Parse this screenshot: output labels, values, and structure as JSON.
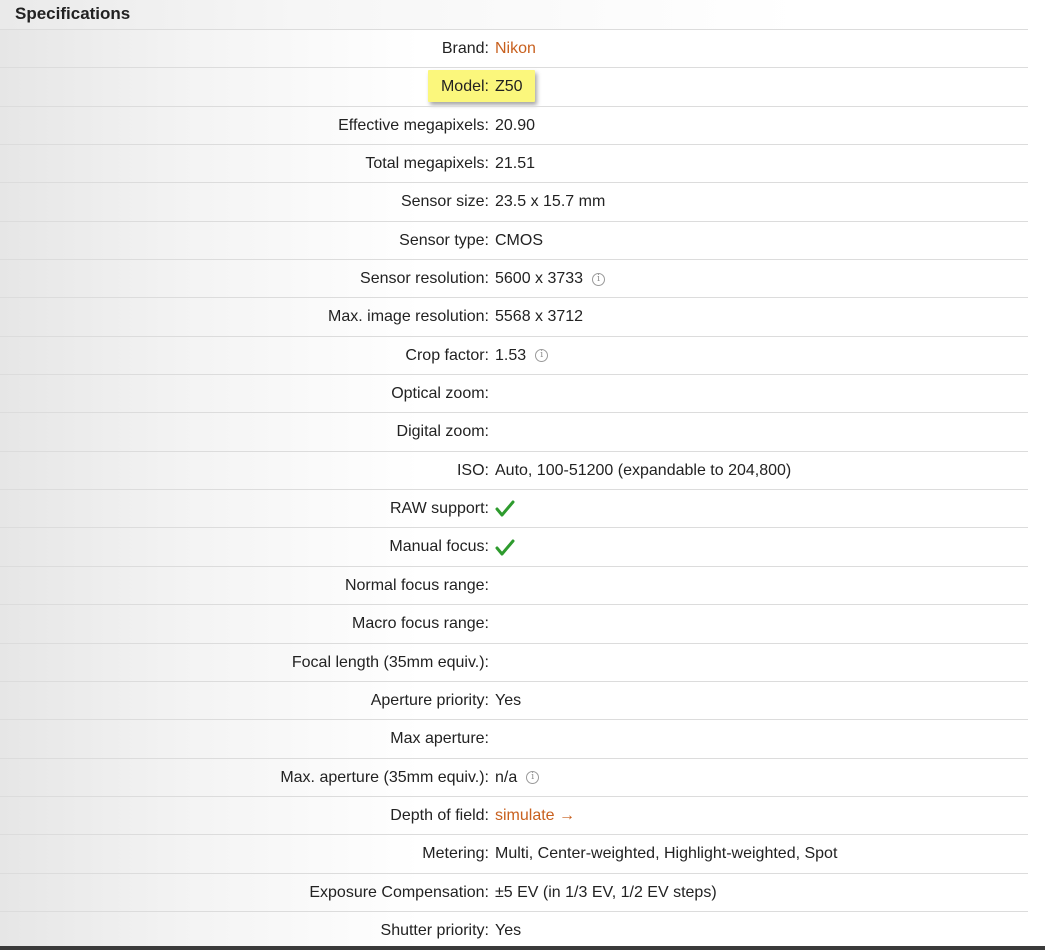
{
  "section": {
    "title": "Specifications"
  },
  "specs": [
    {
      "label": "Brand:",
      "value": "Nikon",
      "value_type": "link"
    },
    {
      "label": "Model:",
      "value": "Z50",
      "highlighted": true
    },
    {
      "label": "Effective megapixels:",
      "value": "20.90"
    },
    {
      "label": "Total megapixels:",
      "value": "21.51"
    },
    {
      "label": "Sensor size:",
      "value": "23.5 x 15.7 mm"
    },
    {
      "label": "Sensor type:",
      "value": "CMOS"
    },
    {
      "label": "Sensor resolution:",
      "value": "5600 x 3733",
      "info_icon": true
    },
    {
      "label": "Max. image resolution:",
      "value": "5568 x 3712"
    },
    {
      "label": "Crop factor:",
      "value": "1.53",
      "info_icon": true
    },
    {
      "label": "Optical zoom:",
      "value": ""
    },
    {
      "label": "Digital zoom:",
      "value": ""
    },
    {
      "label": "ISO:",
      "value": "Auto, 100-51200 (expandable to 204,800)"
    },
    {
      "label": "RAW support:",
      "value": "",
      "icon": "check-icon"
    },
    {
      "label": "Manual focus:",
      "value": "",
      "icon": "check-icon"
    },
    {
      "label": "Normal focus range:",
      "value": ""
    },
    {
      "label": "Macro focus range:",
      "value": ""
    },
    {
      "label": "Focal length (35mm equiv.):",
      "value": ""
    },
    {
      "label": "Aperture priority:",
      "value": "Yes"
    },
    {
      "label": "Max aperture:",
      "value": ""
    },
    {
      "label": "Max. aperture (35mm equiv.):",
      "value": "n/a",
      "info_icon": true
    },
    {
      "label": "Depth of field:",
      "value": "simulate →",
      "value_type": "link"
    },
    {
      "label": "Metering:",
      "value": "Multi, Center-weighted, Highlight-weighted, Spot"
    },
    {
      "label": "Exposure Compensation:",
      "value": "±5 EV (in 1/3 EV, 1/2 EV steps)"
    },
    {
      "label": "Shutter priority:",
      "value": "Yes"
    }
  ],
  "colors": {
    "link": "#c8601e",
    "check": "#2e9b2e",
    "highlight": "#fbf77c",
    "row_border": "#dcdcdc"
  },
  "icons": {
    "info": "info-icon",
    "check": "check-icon"
  }
}
